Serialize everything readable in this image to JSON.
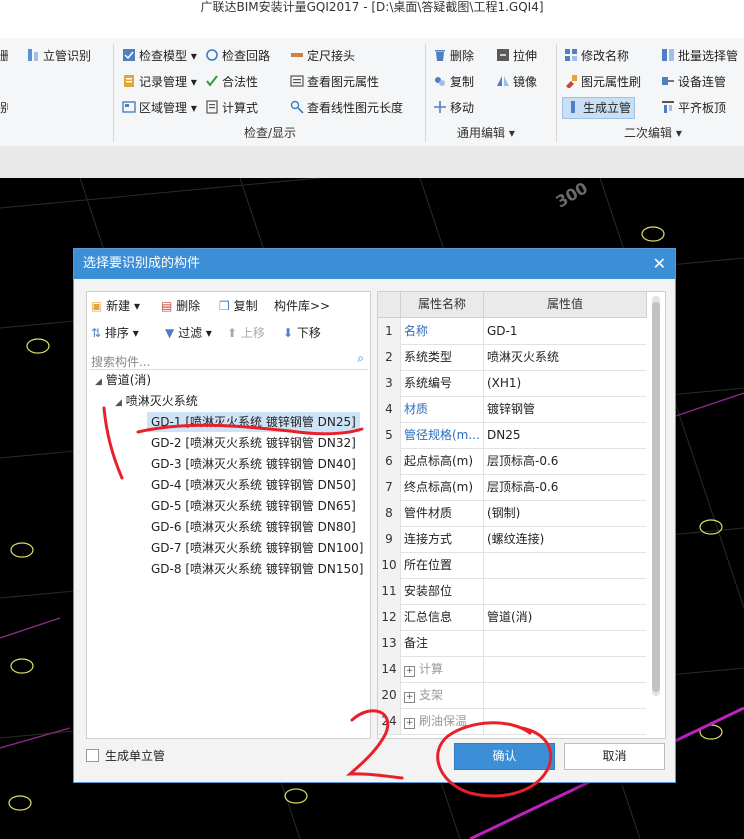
{
  "window_title": "广联达BIM安装计量GQI2017 - [D:\\桌面\\答疑截图\\工程1.GQI4]",
  "ribbon": {
    "left_partial": {
      "item1": "立管识别"
    },
    "check_group": {
      "items": [
        "检查模型",
        "检查回路",
        "定尺接头",
        "记录管理",
        "合法性",
        "查看图元属性",
        "区域管理",
        "计算式",
        "查看线性图元长度"
      ],
      "label": "检查/显示"
    },
    "edit_group": {
      "items": [
        "删除",
        "拉伸",
        "复制",
        "镜像",
        "移动"
      ],
      "label": "通用编辑"
    },
    "secondary_group": {
      "items": [
        "修改名称",
        "批量选择管",
        "图元属性刷",
        "设备连管",
        "生成立管",
        "平齐板顶"
      ],
      "label": "二次编辑"
    }
  },
  "dialog": {
    "title": "选择要识别成的构件",
    "close_icon": "close-icon",
    "toolbar1": {
      "new": "新建",
      "delete": "删除",
      "copy": "复制",
      "library": "构件库>>"
    },
    "toolbar2": {
      "sort": "排序",
      "filter": "过滤",
      "up": "上移",
      "down": "下移"
    },
    "search_placeholder": "搜索构件...",
    "tree": {
      "root": "管道(消)",
      "child": "喷淋灭火系统",
      "items": [
        "GD-1 [喷淋灭火系统 镀锌钢管 DN25]",
        "GD-2 [喷淋灭火系统 镀锌钢管 DN32]",
        "GD-3 [喷淋灭火系统 镀锌钢管 DN40]",
        "GD-4 [喷淋灭火系统 镀锌钢管 DN50]",
        "GD-5 [喷淋灭火系统 镀锌钢管 DN65]",
        "GD-6 [喷淋灭火系统 镀锌钢管 DN80]",
        "GD-7 [喷淋灭火系统 镀锌钢管 DN100]",
        "GD-8 [喷淋灭火系统 镀锌钢管 DN150]"
      ],
      "selected_index": 0
    },
    "props": {
      "header_name": "属性名称",
      "header_value": "属性值",
      "rows": [
        {
          "num": "1",
          "name": "名称",
          "value": "GD-1",
          "blue": true
        },
        {
          "num": "2",
          "name": "系统类型",
          "value": "喷淋灭火系统",
          "blue": false
        },
        {
          "num": "3",
          "name": "系统编号",
          "value": "(XH1)",
          "blue": false
        },
        {
          "num": "4",
          "name": "材质",
          "value": "镀锌钢管",
          "blue": true
        },
        {
          "num": "5",
          "name": "管径规格(m...",
          "value": "DN25",
          "blue": true
        },
        {
          "num": "6",
          "name": "起点标高(m)",
          "value": "层顶标高-0.6",
          "blue": false
        },
        {
          "num": "7",
          "name": "终点标高(m)",
          "value": "层顶标高-0.6",
          "blue": false
        },
        {
          "num": "8",
          "name": "管件材质",
          "value": "(钢制)",
          "blue": false
        },
        {
          "num": "9",
          "name": "连接方式",
          "value": "(螺纹连接)",
          "blue": false
        },
        {
          "num": "10",
          "name": "所在位置",
          "value": "",
          "blue": false
        },
        {
          "num": "11",
          "name": "安装部位",
          "value": "",
          "blue": false
        },
        {
          "num": "12",
          "name": "汇总信息",
          "value": "管道(消)",
          "blue": false
        },
        {
          "num": "13",
          "name": "备注",
          "value": "",
          "blue": false
        },
        {
          "num": "14",
          "name": "计算",
          "value": "",
          "blue": false,
          "group": true
        },
        {
          "num": "20",
          "name": "支架",
          "value": "",
          "blue": false,
          "group": true
        },
        {
          "num": "24",
          "name": "刷油保温",
          "value": "",
          "blue": false,
          "group": true
        }
      ]
    },
    "checkbox_label": "生成单立管",
    "ok_label": "确认",
    "cancel_label": "取消"
  },
  "colors": {
    "accent": "#3c8fd6",
    "annotation": "#e8202a",
    "canvas": "#000000"
  }
}
